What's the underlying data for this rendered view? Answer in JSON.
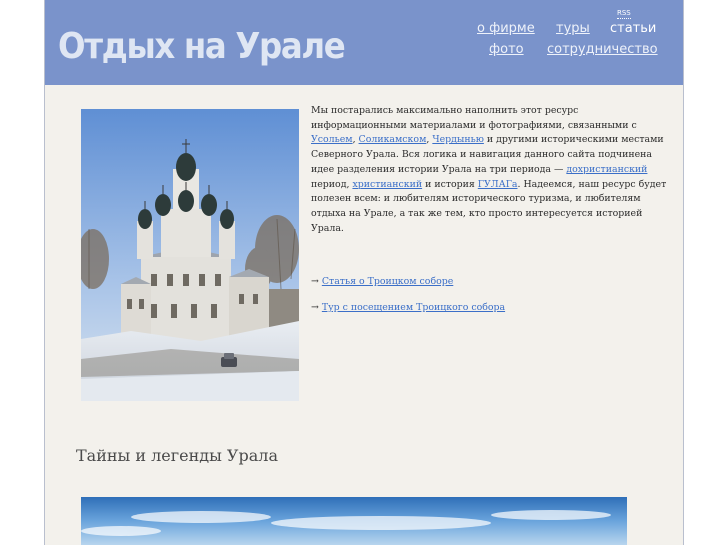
{
  "header": {
    "site_title": "Отдых на Урале",
    "rss_label": "RSS",
    "nav": {
      "about": "о фирме",
      "tours": "туры",
      "articles": "статьи",
      "photo": "фото",
      "cooperation": "сотрудничество"
    },
    "colors": {
      "header_bg": "#7a93cb",
      "page_bg": "#f3f1ec",
      "link": "#3b6fc8"
    }
  },
  "intro": {
    "t1": "Мы постарались максимально наполнить этот ресурс информационными материалами и фотографиями, связанными с ",
    "link_usolye": "Усольем",
    "t2": ", ",
    "link_solikamsk": "Соликамском",
    "t3": ", ",
    "link_cherdyn": "Чердынью",
    "t4": " и другими историческими местами Северного Урала. Вся логика и навигация данного сайта подчинена идее разделения истории Урала на три периода — ",
    "link_prechristian": "дохристианский",
    "t5": " период, ",
    "link_christian": "христианский",
    "t6": " и история ",
    "link_gulag": "ГУЛАГа",
    "t7": ". Надеемся, наш ресурс будет полезен всем: и любителям исторического туризма, и любителям отдыха на Урале, а так же тем, кто просто интересуется историей Урала."
  },
  "links": {
    "arrow": "→",
    "article": "Статья о Троицком соборе",
    "tour": "Тур с посещением Троицкого собора"
  },
  "section": {
    "heading": "Тайны и легенды Урала"
  },
  "images": {
    "church_photo": "photo-of-white-church-in-winter",
    "panorama": "sky-panorama-photo"
  }
}
